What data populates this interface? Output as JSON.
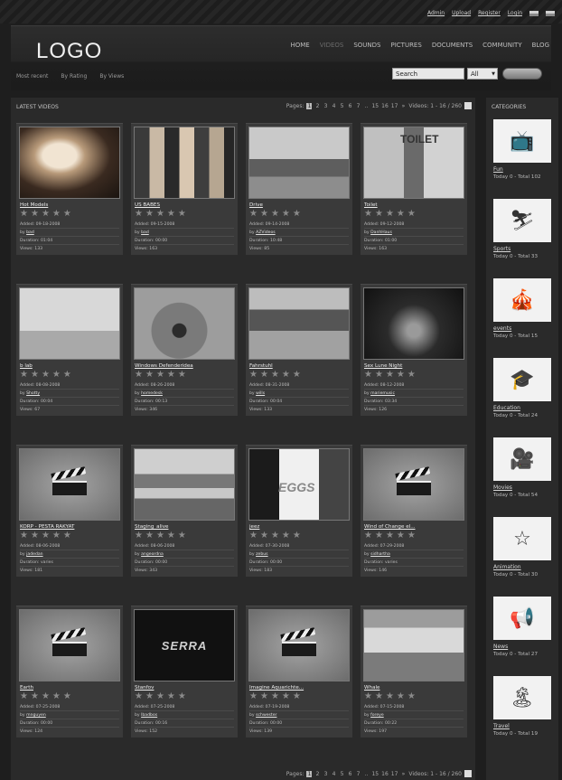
{
  "toplinks": [
    "Admin",
    "Upload",
    "Register",
    "Login"
  ],
  "header": {
    "logo": "LOGO",
    "nav": [
      "HOME",
      "VIDEOS",
      "SOUNDS",
      "PICTURES",
      "DOCUMENTS",
      "COMMUNITY",
      "BLOG"
    ],
    "active_nav": "VIDEOS",
    "subnav": [
      "Most recent",
      "By Rating",
      "By Views"
    ],
    "search_value": "Search",
    "select_value": "All"
  },
  "content": {
    "title": "LATEST VIDEOS",
    "pager_top": {
      "label": "Pages:",
      "pages": [
        "1",
        "2",
        "3",
        "4",
        "5",
        "6",
        "7",
        "..",
        "15",
        "16",
        "17",
        "»"
      ],
      "current": "1",
      "videos": "Videos: 1 - 16 / 260"
    },
    "pager_bottom": {
      "label": "Pages:",
      "pages": [
        "1",
        "2",
        "3",
        "4",
        "5",
        "6",
        "7",
        "..",
        "15",
        "16",
        "17",
        "»"
      ],
      "current": "1",
      "videos": "Videos: 1 - 16 / 260"
    }
  },
  "videos": [
    {
      "title": "Hot Models",
      "added": "Added: 09-18-2008",
      "by": "bad",
      "duration": "Duration: 01:04",
      "views": "Views: 133"
    },
    {
      "title": "US BABES",
      "added": "Added: 09-15-2008",
      "by": "bad",
      "duration": "Duration: 00:00",
      "views": "Views: 163"
    },
    {
      "title": "Drive",
      "added": "Added: 09-14-2008",
      "by": "AZVideos",
      "duration": "Duration: 10:48",
      "views": "Views: 85"
    },
    {
      "title": "Toilet",
      "added": "Added: 09-12-2008",
      "by": "DanhHaus",
      "duration": "Duration: 01:00",
      "views": "Views: 163"
    },
    {
      "title": "b lab",
      "added": "Added: 08-08-2008",
      "by": "Shotty",
      "duration": "Duration: 00:04",
      "views": "Views: 67"
    },
    {
      "title": "Windows Defenderidea",
      "added": "Added: 08-26-2008",
      "by": "homedesk",
      "duration": "Duration: 00:13",
      "views": "Views: 346"
    },
    {
      "title": "Fahrstuhl",
      "added": "Added: 08-31-2008",
      "by": "wills",
      "duration": "Duration: 00:04",
      "views": "Views: 133"
    },
    {
      "title": "Sex Lune Night",
      "added": "Added: 08-12-2008",
      "by": "mariemusic",
      "duration": "Duration: 03:34",
      "views": "Views: 126"
    },
    {
      "title": "KORP - PESTA RAKYAT",
      "added": "Added: 08-06-2008",
      "by": "jadedan",
      "duration": "Duration: varies",
      "views": "Views: 181"
    },
    {
      "title": "Staging_alive",
      "added": "Added: 08-06-2008",
      "by": "angeordna",
      "duration": "Duration: 00:00",
      "views": "Views: 343"
    },
    {
      "title": "jeez",
      "added": "Added: 07-30-2008",
      "by": "zebus",
      "duration": "Duration: 00:00",
      "views": "Views: 183"
    },
    {
      "title": "Wind of Change el...",
      "added": "Added: 07-29-2008",
      "by": "sidhartha",
      "duration": "Duration: varies",
      "views": "Views: 146"
    },
    {
      "title": "Earth",
      "added": "Added: 07-25-2008",
      "by": "mnguyen",
      "duration": "Duration: 00:00",
      "views": "Views: 124"
    },
    {
      "title": "Stanfov",
      "added": "Added: 07-25-2008",
      "by": "lbadbos",
      "duration": "Duration: 00:16",
      "views": "Views: 152"
    },
    {
      "title": "Imagine Aquarichte...",
      "added": "Added: 07-19-2008",
      "by": "schwester",
      "duration": "Duration: 00:00",
      "views": "Views: 139"
    },
    {
      "title": "Whale",
      "added": "Added: 07-15-2008",
      "by": "foreye",
      "duration": "Duration: 00:22",
      "views": "Views: 197"
    }
  ],
  "sidebar": {
    "title": "CATEGORIES",
    "categories": [
      {
        "name": "Fun",
        "stat": "Today 0 - Total 102"
      },
      {
        "name": "Sports",
        "stat": "Today 0 - Total 33"
      },
      {
        "name": "events",
        "stat": "Today 0 - Total 15"
      },
      {
        "name": "Education",
        "stat": "Today 0 - Total 24"
      },
      {
        "name": "Movies",
        "stat": "Today 0 - Total 54"
      },
      {
        "name": "Animation",
        "stat": "Today 0 - Total 30"
      },
      {
        "name": "News",
        "stat": "Today 0 - Total 27"
      },
      {
        "name": "Travel",
        "stat": "Today 0 - Total 19"
      }
    ]
  }
}
